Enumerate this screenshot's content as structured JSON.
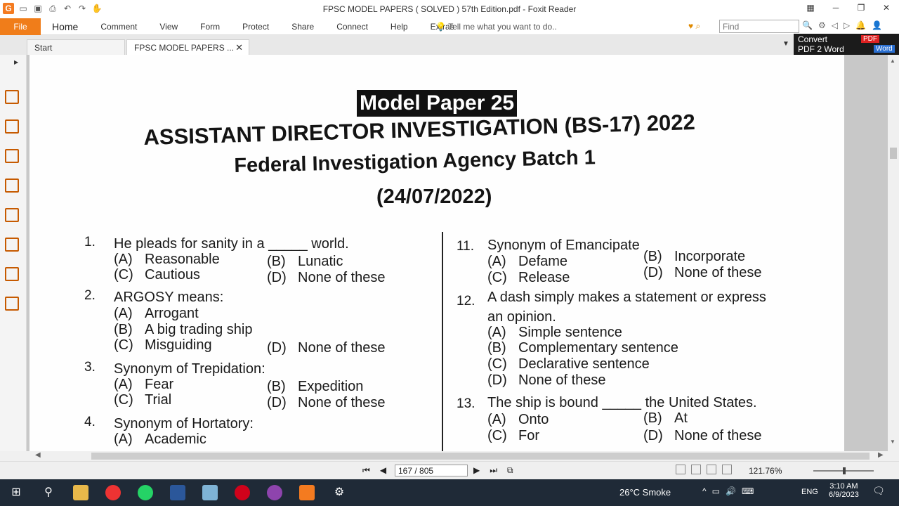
{
  "window": {
    "title": "FPSC MODEL PAPERS  ( SOLVED ) 57th Edition.pdf - Foxit Reader"
  },
  "ribbon": {
    "file_label": "File",
    "tabs": [
      "Home",
      "Comment",
      "View",
      "Form",
      "Protect",
      "Share",
      "Connect",
      "Help",
      "Extras"
    ],
    "tell_me": "Tell me what you want to do..",
    "find_placeholder": "Find"
  },
  "doc_tabs": {
    "start_label": "Start",
    "file_label": "FPSC MODEL PAPERS  ..."
  },
  "convert": {
    "line1": "Convert",
    "line2": "PDF 2 Word",
    "pdf_badge": "PDF",
    "word_badge": "Word"
  },
  "pdf": {
    "model_paper": "Model Paper 25",
    "heading1": "ASSISTANT DIRECTOR INVESTIGATION (BS-17) 2022",
    "heading2": "Federal Investigation Agency Batch 1",
    "heading3": "(24/07/2022)",
    "questions_left": [
      {
        "num": "1.",
        "text": "He pleads for sanity in a _____ world.",
        "a": "Reasonable",
        "b": "Lunatic",
        "c": "Cautious",
        "d": "None of these"
      },
      {
        "num": "2.",
        "text": "ARGOSY means:",
        "a": "Arrogant",
        "b": "A big trading ship",
        "c": "Misguiding",
        "d": "None of these"
      },
      {
        "num": "3.",
        "text": "Synonym of Trepidation:",
        "a": "Fear",
        "b": "Expedition",
        "c": "Trial",
        "d": "None of these"
      },
      {
        "num": "4.",
        "text": "Synonym of Hortatory:",
        "a": "Academic"
      }
    ],
    "questions_right": [
      {
        "num": "11.",
        "text": "Synonym of Emancipate",
        "a": "Defame",
        "b": "Incorporate",
        "c": "Release",
        "d": "None of these"
      },
      {
        "num": "12.",
        "text": "A dash simply makes a statement or express",
        "text2": "an opinion.",
        "a": "Simple sentence",
        "b": "Complementary sentence",
        "c": "Declarative sentence",
        "d": "None of these"
      },
      {
        "num": "13.",
        "text": "The ship is bound _____ the United States.",
        "a": "Onto",
        "b": "At",
        "c": "For",
        "d": "None of these"
      }
    ],
    "labels": {
      "a": "(A)",
      "b": "(B)",
      "c": "(C)",
      "d": "(D)"
    }
  },
  "status": {
    "page_indicator": "167 / 805",
    "zoom": "121.76%"
  },
  "taskbar": {
    "weather": "26°C  Smoke",
    "lang": "ENG",
    "time": "3:10 AM",
    "date": "6/9/2023"
  }
}
